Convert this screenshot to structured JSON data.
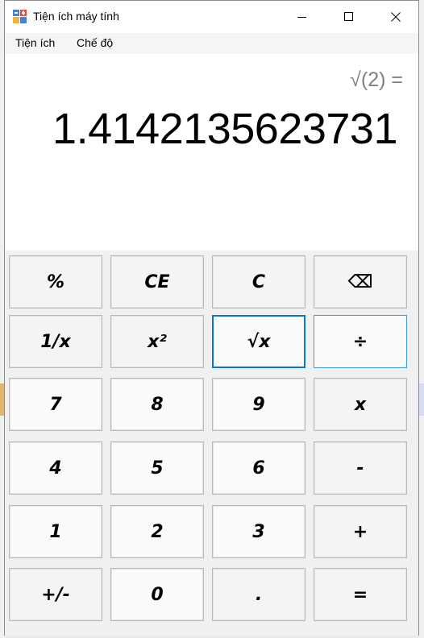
{
  "window": {
    "title": "Tiện ích máy tính"
  },
  "menu": {
    "items": [
      "Tiện ích",
      "Chế độ"
    ]
  },
  "display": {
    "expression": "√(2) =",
    "result": "1.4142135623731"
  },
  "keypad": {
    "rows": [
      [
        "%",
        "CE",
        "C",
        "⌫"
      ],
      [
        "1/x",
        "x²",
        "√x",
        "÷"
      ],
      [
        "7",
        "8",
        "9",
        "x"
      ],
      [
        "4",
        "5",
        "6",
        "-"
      ],
      [
        "1",
        "2",
        "3",
        "+"
      ],
      [
        "+/-",
        "0",
        ".",
        "="
      ]
    ]
  },
  "colors": {
    "focus_border": "#0a76d6",
    "hover_border": "#3c9be3",
    "expression_text": "#808080"
  },
  "icons": {
    "app": "calculator-app-icon",
    "minimize": "minimize-icon",
    "maximize": "maximize-icon",
    "close": "close-icon"
  }
}
